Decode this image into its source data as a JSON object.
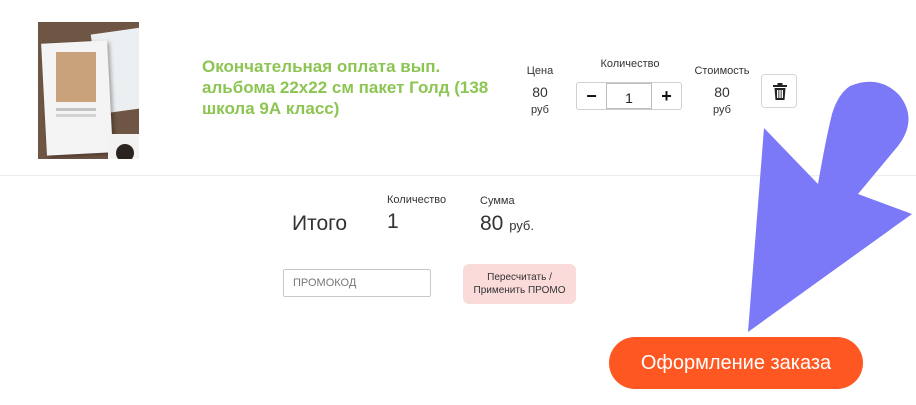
{
  "product": {
    "image_alt": "album photo",
    "title": "Окончательная оплата вып. альбома 22х22 см пакет Голд (138 школа 9А класс)"
  },
  "columns": {
    "price_label": "Цена",
    "price_value": "80",
    "price_unit": "руб",
    "quantity_label": "Количество",
    "quantity_value": "1",
    "minus_symbol": "−",
    "plus_symbol": "+",
    "cost_label": "Стоимость",
    "cost_value": "80",
    "cost_unit": "руб"
  },
  "icons": {
    "delete": "trash-icon",
    "pointer": "arrow-icon"
  },
  "summary": {
    "total_label": "Итого",
    "quantity_label": "Количество",
    "quantity_value": "1",
    "sum_label": "Сумма",
    "sum_value": "80",
    "sum_unit": "руб."
  },
  "promo": {
    "placeholder": "ПРОМОКОД",
    "recalc_line1": "Пересчитать /",
    "recalc_line2": "Применить ПРОМО"
  },
  "checkout": {
    "label": "Оформление заказа"
  },
  "colors": {
    "title_green": "#8cc552",
    "checkout_orange": "#ff5722",
    "promo_pink": "#fbdada",
    "arrow_purple": "#7b79f7"
  }
}
